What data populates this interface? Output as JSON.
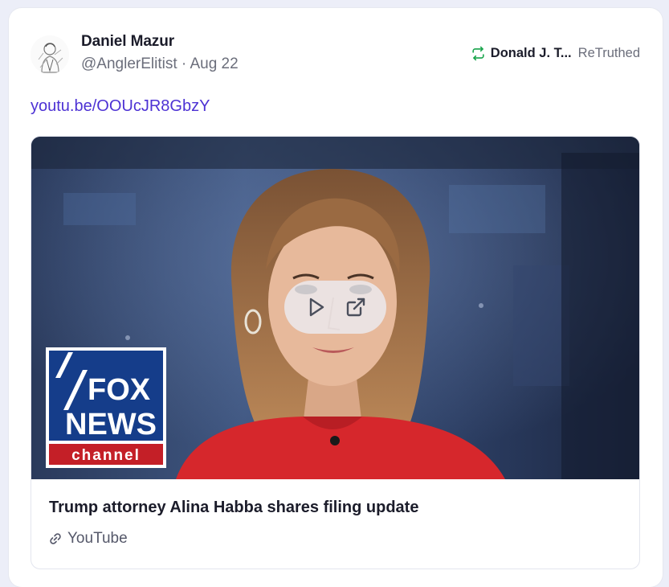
{
  "post": {
    "author": {
      "display_name": "Daniel Mazur",
      "handle": "@AnglerElitist",
      "avatar_icon": "sketch-portrait-avatar"
    },
    "date": "Aug 22",
    "meta_separator": " · ",
    "retruth": {
      "icon": "retruth-icon",
      "user": "Donald J. T...",
      "label": "ReTruthed",
      "color": "#17a34a"
    },
    "link_text": "youtu.be/OOUcJR8GbzY",
    "link_color": "#4d32d4",
    "preview": {
      "title": "Trump attorney Alina Habba shares filing update",
      "source": "YouTube",
      "source_icon": "link-icon",
      "thumbnail": {
        "description_icon": "news-anchor-thumbnail",
        "logo_lines": [
          "FOX",
          "NEWS",
          "channel"
        ],
        "controls": [
          "play-icon",
          "external-link-icon"
        ]
      }
    }
  }
}
